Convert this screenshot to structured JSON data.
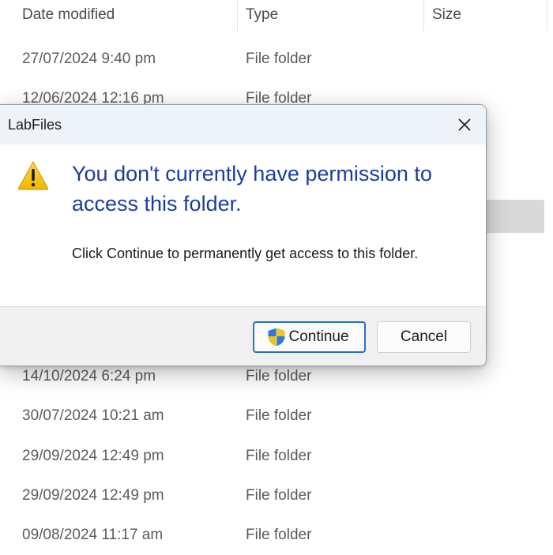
{
  "explorer": {
    "columns": {
      "date_modified": "Date modified",
      "type": "Type",
      "size": "Size"
    },
    "rows": [
      {
        "date": "27/07/2024 9:40 pm",
        "type": "File folder"
      },
      {
        "date": "12/06/2024 12:16 pm",
        "type": "File folder"
      },
      {
        "date": "14/10/2024 6:24 pm",
        "type": "File folder"
      },
      {
        "date": "30/07/2024 10:21 am",
        "type": "File folder"
      },
      {
        "date": "29/09/2024 12:49 pm",
        "type": "File folder"
      },
      {
        "date": "29/09/2024 12:49 pm",
        "type": "File folder"
      },
      {
        "date": "09/08/2024 11:17 am",
        "type": "File folder"
      }
    ]
  },
  "dialog": {
    "title": "LabFiles",
    "main_instruction": "You don't currently have permission to access this folder.",
    "content": "Click Continue to permanently get access to this folder.",
    "continue_label": "Continue",
    "cancel_label": "Cancel",
    "icons": {
      "warning": "warning-icon",
      "shield": "uac-shield-icon",
      "close": "close-icon"
    },
    "colors": {
      "main_instruction": "#1a3e9b",
      "continue_border": "#2b6fc6",
      "titlebar": "#eef3fa",
      "warning_yellow": "#f5c400"
    }
  }
}
